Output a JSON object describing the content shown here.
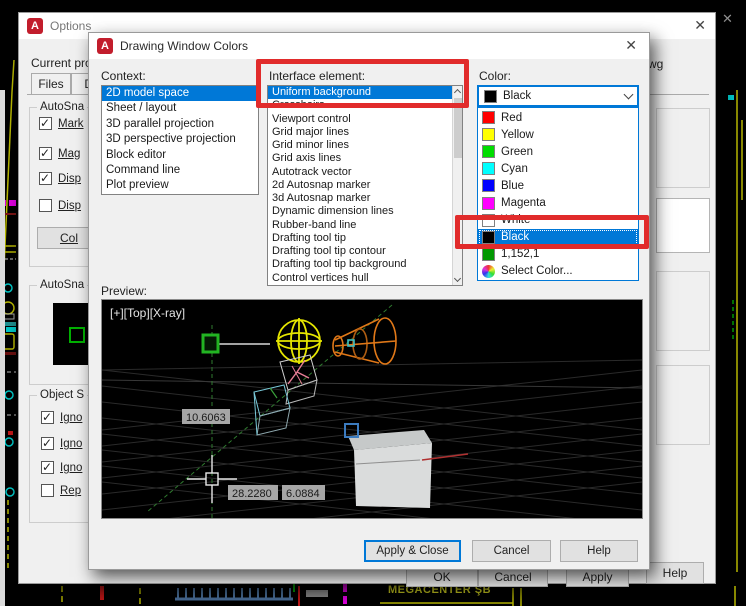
{
  "cad": {
    "bottom_text": "MEGACENTER ŞB"
  },
  "annotations": {
    "highlight_color": "#E12B2B"
  },
  "options_dialog": {
    "title": "Options",
    "close_glyph": "✕",
    "current_profile_label": "Current profil",
    "drawing_name_fragment": "wg",
    "tabs": [
      {
        "label": "Files"
      },
      {
        "label": "Di"
      }
    ],
    "groups": {
      "autosnap_settings_label": "AutoSna",
      "autosnap_marker_label": "AutoSna",
      "object_snap_label": "Object S"
    },
    "autosnap_checkboxes": [
      {
        "label": "Mark",
        "checked": true
      },
      {
        "label": "Mag",
        "checked": true
      },
      {
        "label": "Disp",
        "checked": true
      },
      {
        "label": "Disp",
        "checked": false
      }
    ],
    "colors_button_label": "Col",
    "object_snap_checkboxes": [
      {
        "label": "Igno",
        "checked": true
      },
      {
        "label": "Igno",
        "checked": true
      },
      {
        "label": "Igno",
        "checked": true
      },
      {
        "label": "Rep",
        "checked": false
      }
    ],
    "buttons": {
      "ok": "OK",
      "cancel": "Cancel",
      "apply": "Apply",
      "help": "Help"
    }
  },
  "colors_dialog": {
    "title": "Drawing Window Colors",
    "close_glyph": "✕",
    "context_label": "Context:",
    "context_items": [
      "2D model space",
      "Sheet / layout",
      "3D parallel projection",
      "3D perspective projection",
      "Block editor",
      "Command line",
      "Plot preview"
    ],
    "interface_label": "Interface element:",
    "interface_items": [
      "Uniform background",
      "Crosshairs",
      "Viewport control",
      "Grid major lines",
      "Grid minor lines",
      "Grid axis lines",
      "Autotrack vector",
      "2d Autosnap marker",
      "3d Autosnap marker",
      "Dynamic dimension lines",
      "Rubber-band line",
      "Drafting tool tip",
      "Drafting tool tip contour",
      "Drafting tool tip background",
      "Control vertices hull"
    ],
    "color_label": "Color:",
    "color_combo": {
      "value": "Black",
      "swatch": "#000000"
    },
    "color_dropdown": [
      {
        "name": "Red",
        "swatch": "#FF0000"
      },
      {
        "name": "Yellow",
        "swatch": "#FFFF00"
      },
      {
        "name": "Green",
        "swatch": "#00DD00"
      },
      {
        "name": "Cyan",
        "swatch": "#00FFFF"
      },
      {
        "name": "Blue",
        "swatch": "#0000FF"
      },
      {
        "name": "Magenta",
        "swatch": "#FF00FF"
      },
      {
        "name": "White",
        "swatch": "#FFFFFF"
      },
      {
        "name": "Black",
        "swatch": "#000000"
      },
      {
        "name": "1,152,1",
        "swatch": "#019801"
      },
      {
        "name": "Select Color...",
        "swatch": "wheel"
      }
    ],
    "preview_label": "Preview:",
    "preview": {
      "viewport_label": "[+][Top][X-ray]",
      "coord_y": "10.6063",
      "coord_x": "28.2280",
      "coord_z": "6.0884"
    },
    "buttons": {
      "apply_close": "Apply & Close",
      "cancel": "Cancel",
      "help": "Help"
    }
  }
}
